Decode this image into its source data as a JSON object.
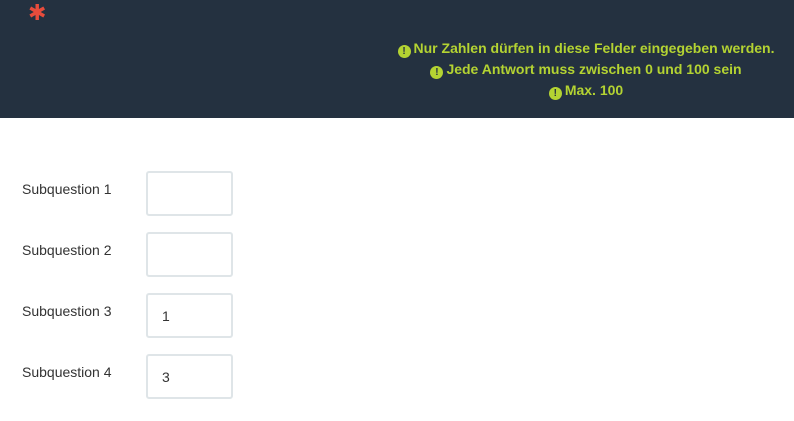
{
  "header": {
    "required_mark": "✱",
    "tips": [
      {
        "icon": "exclamation-circle-icon",
        "text": "Nur Zahlen dürfen in diese Felder eingegeben werden."
      },
      {
        "icon": "exclamation-circle-icon",
        "text": "Jede Antwort muss zwischen 0 und 100 sein"
      },
      {
        "icon": "exclamation-circle-icon",
        "text": "Max. 100"
      }
    ]
  },
  "subquestions": [
    {
      "label": "Subquestion 1",
      "value": ""
    },
    {
      "label": "Subquestion 2",
      "value": ""
    },
    {
      "label": "Subquestion 3",
      "value": "1"
    },
    {
      "label": "Subquestion 4",
      "value": "3"
    }
  ],
  "colors": {
    "header_bg": "#243140",
    "tip_text": "#b4d332",
    "required_star": "#e74c3c",
    "input_border": "#dfe5e8"
  }
}
